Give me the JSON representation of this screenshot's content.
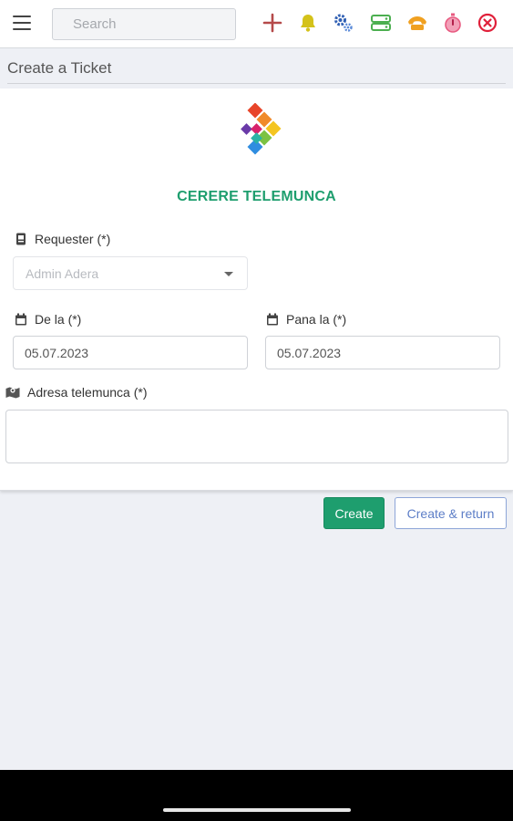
{
  "topbar": {
    "search": {
      "placeholder": "Search",
      "value": ""
    },
    "icons": [
      {
        "name": "plus-icon",
        "color": "#b54a4a"
      },
      {
        "name": "bell-icon",
        "color": "#d4c21a"
      },
      {
        "name": "cogs-icon",
        "color": "#3d6fc4"
      },
      {
        "name": "server-icon",
        "color": "#4caf50"
      },
      {
        "name": "phone-icon",
        "color": "#f0a020"
      },
      {
        "name": "stopwatch-icon",
        "color": "#e85a80"
      },
      {
        "name": "close-circle-icon",
        "color": "#e0203a"
      }
    ]
  },
  "page": {
    "title": "Create a Ticket"
  },
  "form": {
    "title": "CERERE TELEMUNCA",
    "title_color": "#1e9e6e",
    "requester": {
      "label": "Requester (*)",
      "value": "Admin Adera",
      "icon": "id-badge-icon"
    },
    "date_from": {
      "label": "De la (*)",
      "value": "05.07.2023",
      "icon": "calendar-icon"
    },
    "date_to": {
      "label": "Pana la (*)",
      "value": "05.07.2023",
      "icon": "calendar-icon"
    },
    "address": {
      "label": "Adresa telemunca (*)",
      "value": "",
      "icon": "map-icon"
    }
  },
  "actions": {
    "create_label": "Create",
    "create_return_label": "Create & return"
  },
  "colors": {
    "accent": "#1e9e6e",
    "secondary": "#5d7ec7",
    "background": "#eef0f5"
  }
}
